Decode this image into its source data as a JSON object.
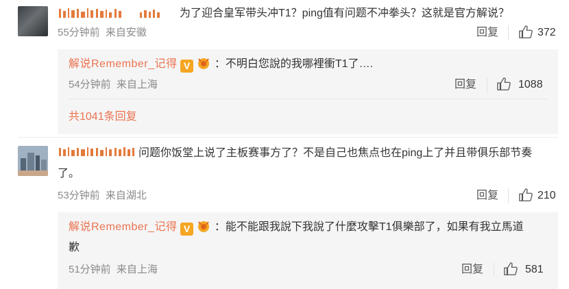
{
  "comments": [
    {
      "text": "为了迎合皇军带头冲T1？ping值有问题不冲拳头？这就是官方解说？",
      "time": "55分钟前",
      "location": "来自安徽",
      "reply_label": "回复",
      "likes": "372",
      "sub_reply": {
        "username": "解说Remember_记得",
        "text": "：不明白您說的我哪裡衝T1了….",
        "time": "54分钟前",
        "location": "来自上海",
        "reply_label": "回复",
        "likes": "1088"
      },
      "more_replies": "共1041条回复"
    },
    {
      "text_line1": "问题你饭堂上说了主板赛事方了？不是自己也焦点也在ping上了并且带俱乐部节奏",
      "text_line2": "了。",
      "time": "53分钟前",
      "location": "来自湖北",
      "reply_label": "回复",
      "likes": "210",
      "sub_reply": {
        "username": "解说Remember_记得",
        "text_line1": "：能不能跟我說下我說了什麼攻擊T1俱樂部了，如果有我立馬道",
        "text_line2": "歉",
        "time": "51分钟前",
        "location": "来自上海",
        "reply_label": "回复",
        "likes": "581"
      }
    }
  ],
  "colors": {
    "username": "#eb7350",
    "badge": "#f5a623",
    "meta": "#8a8a8a"
  },
  "icons": [
    "thumbs-up-icon",
    "verified-badge-icon",
    "fan-badge-icon"
  ]
}
